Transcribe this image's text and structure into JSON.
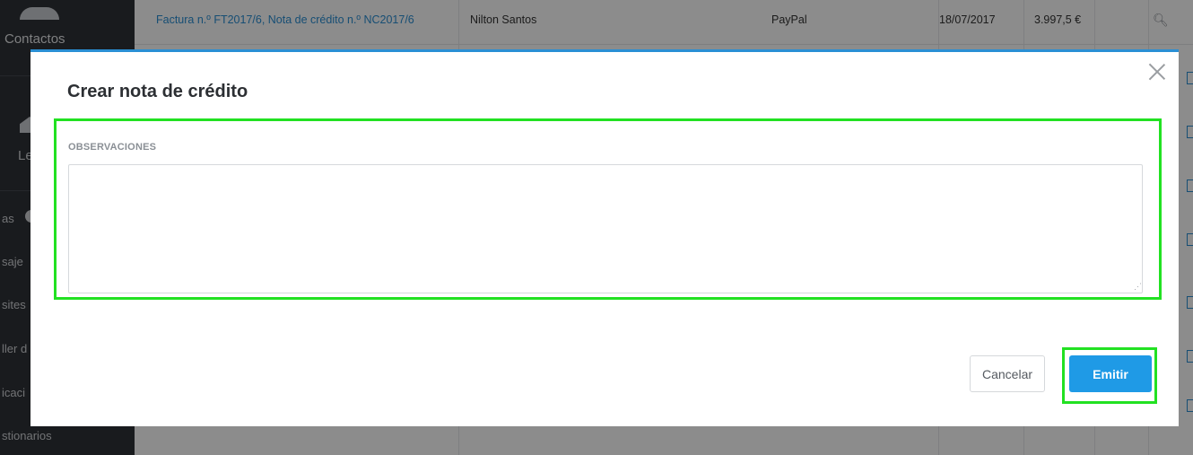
{
  "sidebar": {
    "contactos": "Contactos",
    "partial_items": [
      "Le",
      "as",
      "saje",
      "sites",
      "ller d",
      "icaci",
      "stionarios"
    ]
  },
  "table": {
    "rows": [
      {
        "documento": "Factura n.º FT2017/6, Nota de crédito n.º NC2017/6",
        "cliente": "Nilton Santos",
        "metodo": "PayPal",
        "fecha": "18/07/2017",
        "importe": "3.997,5 €"
      }
    ]
  },
  "modal": {
    "title": "Crear nota de crédito",
    "observaciones_label": "OBSERVACIONES",
    "observaciones_value": "",
    "cancel_label": "Cancelar",
    "emit_label": "Emitir"
  },
  "colors": {
    "accent": "#1f9ae6",
    "highlight": "#22e122",
    "sidebar_bg": "#2f3238"
  },
  "icons": [
    "close-icon",
    "search-icon",
    "document-icon",
    "user-icon",
    "home-icon"
  ]
}
